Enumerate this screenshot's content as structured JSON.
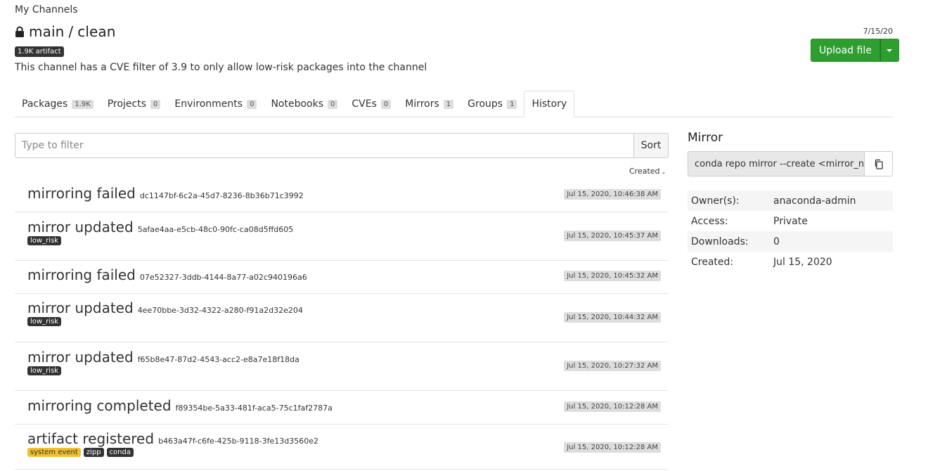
{
  "breadcrumb": "My Channels",
  "channel": {
    "part1": "main",
    "sep": "/",
    "part2": "clean"
  },
  "artifact_badge": "1.9K artifact",
  "description": "This channel has a CVE filter of 3.9 to only allow low-risk packages into the channel",
  "header_date": "7/15/20",
  "upload_label": "Upload file",
  "colors": {
    "upload_green": "#2e9e30",
    "tag_yellow": "#f0c030"
  },
  "tabs": [
    {
      "label": "Packages",
      "count": "1.9K"
    },
    {
      "label": "Projects",
      "count": "0"
    },
    {
      "label": "Environments",
      "count": "0"
    },
    {
      "label": "Notebooks",
      "count": "0"
    },
    {
      "label": "CVEs",
      "count": "0"
    },
    {
      "label": "Mirrors",
      "count": "1"
    },
    {
      "label": "Groups",
      "count": "1"
    },
    {
      "label": "History",
      "count": null,
      "active": true
    }
  ],
  "filter": {
    "placeholder": "Type to filter",
    "sort_label": "Sort",
    "created_label": "Created"
  },
  "history": [
    {
      "event": "mirroring failed",
      "hash": "dc1147bf-6c2a-45d7-8236-8b36b71c3992",
      "tags": [],
      "ts": "Jul 15, 2020, 10:46:38 AM"
    },
    {
      "event": "mirror updated",
      "hash": "5afae4aa-e5cb-48c0-90fc-ca08d5ffd605",
      "tags": [
        {
          "label": "low_risk",
          "style": "dark"
        }
      ],
      "ts": "Jul 15, 2020, 10:45:37 AM"
    },
    {
      "event": "mirroring failed",
      "hash": "07e52327-3ddb-4144-8a77-a02c940196a6",
      "tags": [],
      "ts": "Jul 15, 2020, 10:45:32 AM"
    },
    {
      "event": "mirror updated",
      "hash": "4ee70bbe-3d32-4322-a280-f91a2d32e204",
      "tags": [
        {
          "label": "low_risk",
          "style": "dark"
        }
      ],
      "ts": "Jul 15, 2020, 10:44:32 AM"
    },
    {
      "event": "mirror updated",
      "hash": "f65b8e47-87d2-4543-acc2-e8a7e18f18da",
      "tags": [
        {
          "label": "low_risk",
          "style": "dark"
        }
      ],
      "ts": "Jul 15, 2020, 10:27:32 AM"
    },
    {
      "event": "mirroring completed",
      "hash": "f89354be-5a33-481f-aca5-75c1faf2787a",
      "tags": [],
      "ts": "Jul 15, 2020, 10:12:28 AM"
    },
    {
      "event": "artifact registered",
      "hash": "b463a47f-c6fe-425b-9118-3fe13d3560e2",
      "tags": [
        {
          "label": "system event",
          "style": "yellow"
        },
        {
          "label": "zipp",
          "style": "dark"
        },
        {
          "label": "conda",
          "style": "dark"
        }
      ],
      "ts": "Jul 15, 2020, 10:12:28 AM"
    }
  ],
  "sidebar": {
    "title": "Mirror",
    "command": "conda repo mirror --create <mirror_n",
    "meta": [
      {
        "key": "Owner(s):",
        "value": "anaconda-admin"
      },
      {
        "key": "Access:",
        "value": "Private"
      },
      {
        "key": "Downloads:",
        "value": "0"
      },
      {
        "key": "Created:",
        "value": "Jul 15, 2020"
      }
    ]
  }
}
